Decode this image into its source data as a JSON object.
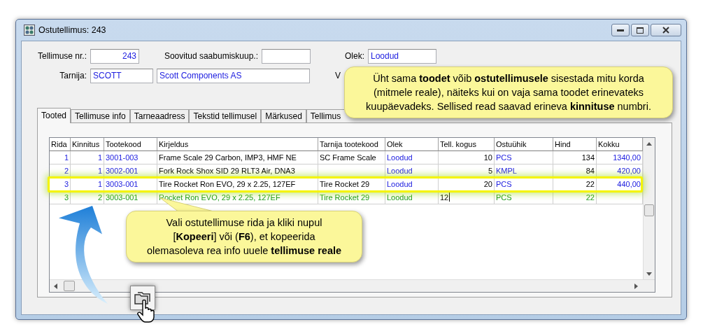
{
  "window": {
    "title": "Ostutellimus: 243"
  },
  "order": {
    "number_label": "Tellimuse nr.:",
    "number": "243",
    "date_label": "Soovitud saabumiskuup.:",
    "status_label": "Olek:",
    "status": "Loodud",
    "supplier_label": "Tarnija:",
    "supplier_code": "SCOTT",
    "supplier_name": "Scott Components AS",
    "currency_label": "V"
  },
  "tabs": [
    {
      "label": "Tooted",
      "selected": true
    },
    {
      "label": "Tellimuse info",
      "selected": false
    },
    {
      "label": "Tarneaadress",
      "selected": false
    },
    {
      "label": "Tekstid tellimusel",
      "selected": false
    },
    {
      "label": "Märkused",
      "selected": false
    },
    {
      "label": "Tellimus",
      "selected": false
    }
  ],
  "grid": {
    "columns": [
      {
        "label": "Rida",
        "kind": "index"
      },
      {
        "label": "Kinnitus",
        "kind": "index"
      },
      {
        "label": "Tootekood",
        "kind": "code"
      },
      {
        "label": "Kirjeldus",
        "kind": "text"
      },
      {
        "label": "Tarnija tootekood",
        "kind": "text"
      },
      {
        "label": "Olek",
        "kind": "status"
      },
      {
        "label": "Tell. kogus",
        "kind": "quantity"
      },
      {
        "label": "Ostuühik",
        "kind": "unit"
      },
      {
        "label": "Hind",
        "kind": "price"
      },
      {
        "label": "Kokku",
        "kind": "total"
      }
    ],
    "rows": [
      {
        "kind": "saved",
        "highlighted": false,
        "editing": false,
        "cells": [
          "1",
          "1",
          "3001-003",
          "Frame Scale 29 Carbon, IMP3, HMF NE",
          "SC Frame Scale",
          "Loodud",
          "10",
          "PCS",
          "134",
          "1340,00"
        ]
      },
      {
        "kind": "saved",
        "highlighted": false,
        "editing": false,
        "cells": [
          "2",
          "1",
          "3002-001",
          "Fork Rock Shox SID 29 RLT3 Air, DNA3",
          null,
          "Loodud",
          "5",
          "KMPL",
          "84",
          "420,00"
        ]
      },
      {
        "kind": "saved",
        "highlighted": true,
        "editing": false,
        "cells": [
          "3",
          "1",
          "3003-001",
          "Tire Rocket Ron EVO, 29 x 2.25, 127EF",
          "Tire Rocket 29",
          "Loodud",
          "20",
          "PCS",
          "22",
          "440,00"
        ]
      },
      {
        "kind": "new",
        "highlighted": false,
        "editing": true,
        "cells": [
          "3",
          "2",
          "3003-001",
          "Rocket Ron EVO, 29 x 2.25, 127EF",
          "Tire Rocket 29",
          "Loodud",
          "12",
          "PCS",
          "22",
          null
        ]
      }
    ]
  },
  "callouts": [
    {
      "lines": [
        "Üht sama **toodet** võib **ostutellimusele** sisestada mitu korda",
        "(mitmele reale), näiteks kui on vaja sama toodet erinevateks",
        "kuupäevadeks.  Sellised read saavad erineva **kinnituse** numbri."
      ]
    },
    {
      "lines": [
        "Vali ostutellimuse rida ja kliki nupul",
        "[**Kopeeri**] või (**F6**), et kopeerida",
        "olemasoleva rea info uuele **tellimuse reale**"
      ]
    }
  ]
}
